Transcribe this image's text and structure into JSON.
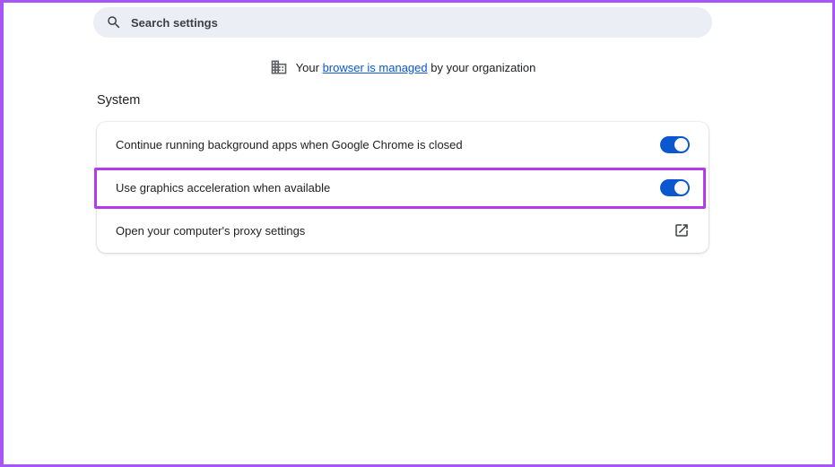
{
  "colors": {
    "frame_border": "#a855f7",
    "highlight_border": "#b23bf0",
    "toggle_on": "#0b57d0",
    "link": "#0b57d0",
    "search_bg": "#eceef5"
  },
  "search": {
    "placeholder": "Search settings",
    "icon": "search-icon"
  },
  "managed_notice": {
    "icon": "organization-building-icon",
    "prefix": "Your ",
    "link_text": "browser is managed",
    "suffix": " by your organization"
  },
  "section": {
    "title": "System"
  },
  "system_card": {
    "rows": [
      {
        "label": "Continue running background apps when Google Chrome is closed",
        "control": "toggle",
        "state": "on"
      },
      {
        "label": "Use graphics acceleration when available",
        "control": "toggle",
        "state": "on",
        "highlighted": true
      },
      {
        "label": "Open your computer's proxy settings",
        "control": "external-link",
        "icon": "open-in-new-icon"
      }
    ]
  }
}
